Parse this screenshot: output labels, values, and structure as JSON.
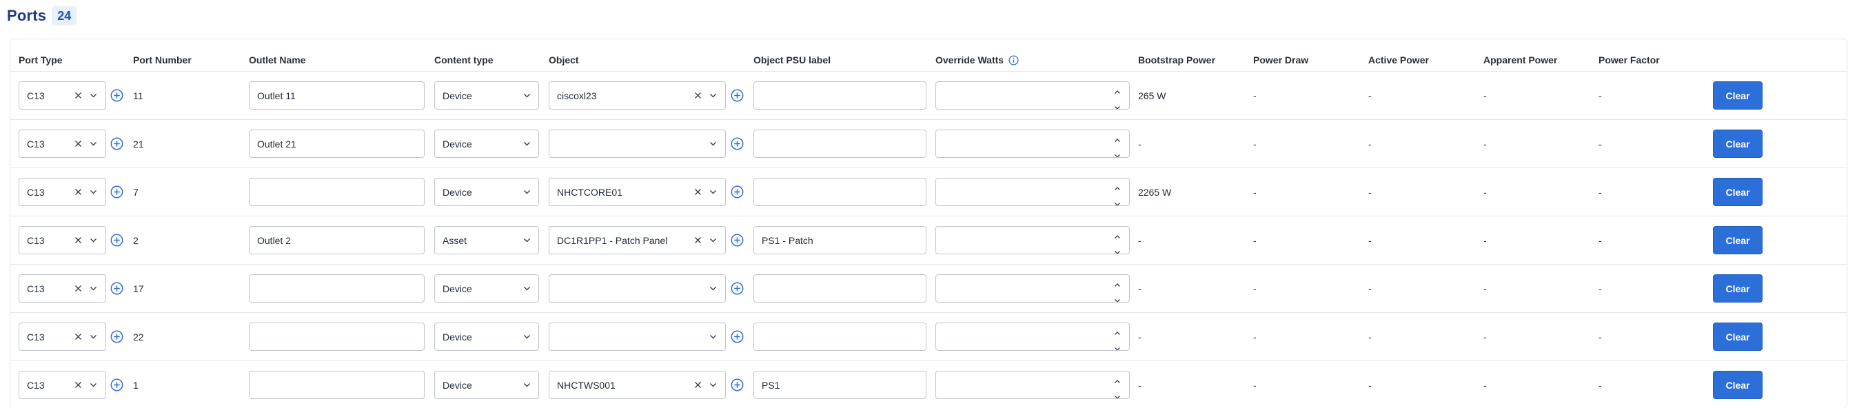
{
  "header": {
    "title": "Ports",
    "count": "24"
  },
  "columns": {
    "port_type": "Port Type",
    "port_number": "Port Number",
    "outlet_name": "Outlet Name",
    "content_type": "Content type",
    "object": "Object",
    "object_psu_label": "Object PSU label",
    "override_watts": "Override Watts",
    "bootstrap_power": "Bootstrap Power",
    "power_draw": "Power Draw",
    "active_power": "Active Power",
    "apparent_power": "Apparent Power",
    "power_factor": "Power Factor"
  },
  "clear_label": "Clear",
  "rows": [
    {
      "port_type": "C13",
      "port_number": "11",
      "outlet_name": "Outlet 11",
      "content_type": "Device",
      "object": "ciscoxl23",
      "psu_label": "",
      "override_watts": "",
      "bootstrap_power": "265 W",
      "power_draw": "-",
      "active_power": "-",
      "apparent_power": "-",
      "power_factor": "-"
    },
    {
      "port_type": "C13",
      "port_number": "21",
      "outlet_name": "Outlet 21",
      "content_type": "Device",
      "object": "",
      "psu_label": "",
      "override_watts": "",
      "bootstrap_power": "-",
      "power_draw": "-",
      "active_power": "-",
      "apparent_power": "-",
      "power_factor": "-"
    },
    {
      "port_type": "C13",
      "port_number": "7",
      "outlet_name": "",
      "content_type": "Device",
      "object": "NHCTCORE01",
      "psu_label": "",
      "override_watts": "",
      "bootstrap_power": "2265 W",
      "power_draw": "-",
      "active_power": "-",
      "apparent_power": "-",
      "power_factor": "-"
    },
    {
      "port_type": "C13",
      "port_number": "2",
      "outlet_name": "Outlet 2",
      "content_type": "Asset",
      "object": "DC1R1PP1 - Patch Panel",
      "psu_label": "PS1 - Patch",
      "override_watts": "",
      "bootstrap_power": "-",
      "power_draw": "-",
      "active_power": "-",
      "apparent_power": "-",
      "power_factor": "-"
    },
    {
      "port_type": "C13",
      "port_number": "17",
      "outlet_name": "",
      "content_type": "Device",
      "object": "",
      "psu_label": "",
      "override_watts": "",
      "bootstrap_power": "-",
      "power_draw": "-",
      "active_power": "-",
      "apparent_power": "-",
      "power_factor": "-"
    },
    {
      "port_type": "C13",
      "port_number": "22",
      "outlet_name": "",
      "content_type": "Device",
      "object": "",
      "psu_label": "",
      "override_watts": "",
      "bootstrap_power": "-",
      "power_draw": "-",
      "active_power": "-",
      "apparent_power": "-",
      "power_factor": "-"
    },
    {
      "port_type": "C13",
      "port_number": "1",
      "outlet_name": "",
      "content_type": "Device",
      "object": "NHCTWS001",
      "psu_label": "PS1",
      "override_watts": "",
      "bootstrap_power": "-",
      "power_draw": "-",
      "active_power": "-",
      "apparent_power": "-",
      "power_factor": "-"
    }
  ]
}
